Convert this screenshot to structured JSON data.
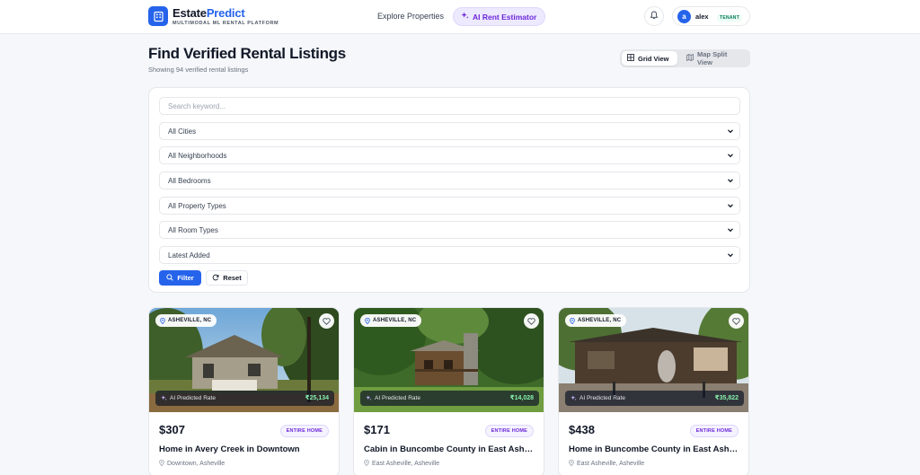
{
  "header": {
    "brand_main": "Estate",
    "brand_accent": "Predict",
    "brand_sub": "MULTIMODAL ML RENTAL PLATFORM",
    "nav_explore": "Explore Properties",
    "nav_ai": "AI Rent Estimator",
    "user_initial": "a",
    "user_name": "alex",
    "user_role": "TENANT"
  },
  "page": {
    "title": "Find Verified Rental Listings",
    "subtitle": "Showing 94 verified rental listings",
    "view_grid": "Grid View",
    "view_map": "Map Split View"
  },
  "filters": {
    "search_placeholder": "Search keyword...",
    "city": "All Cities",
    "neighborhood": "All Neighborhoods",
    "bedrooms": "All Bedrooms",
    "property_type": "All Property Types",
    "room_type": "All Room Types",
    "sort": "Latest Added",
    "filter_label": "Filter",
    "reset_label": "Reset"
  },
  "listings": [
    {
      "location_badge": "ASHEVILLE, NC",
      "ai_label": "AI Predicted Rate",
      "ai_value": "₹25,134",
      "price": "$307",
      "type": "ENTIRE HOME",
      "title": "Home in Avery Creek in Downtown",
      "location": "Downtown, Asheville"
    },
    {
      "location_badge": "ASHEVILLE, NC",
      "ai_label": "AI Predicted Rate",
      "ai_value": "₹14,028",
      "price": "$171",
      "type": "ENTIRE HOME",
      "title": "Cabin in Buncombe County in East Asheville",
      "location": "East Asheville, Asheville"
    },
    {
      "location_badge": "ASHEVILLE, NC",
      "ai_label": "AI Predicted Rate",
      "ai_value": "₹35,822",
      "price": "$438",
      "type": "ENTIRE HOME",
      "title": "Home in Buncombe County in East Asheville",
      "location": "East Asheville, Asheville"
    }
  ],
  "colors": {
    "primary": "#2563eb",
    "ai_accent": "#6d28d9",
    "ai_value": "#86efac",
    "background": "#f5f7fa"
  },
  "icons": [
    "building-logo-icon",
    "sparkle-icon",
    "bell-icon",
    "grid-icon",
    "map-icon",
    "chevron-down-icon",
    "search-icon",
    "refresh-icon",
    "map-pin-icon",
    "heart-icon"
  ]
}
